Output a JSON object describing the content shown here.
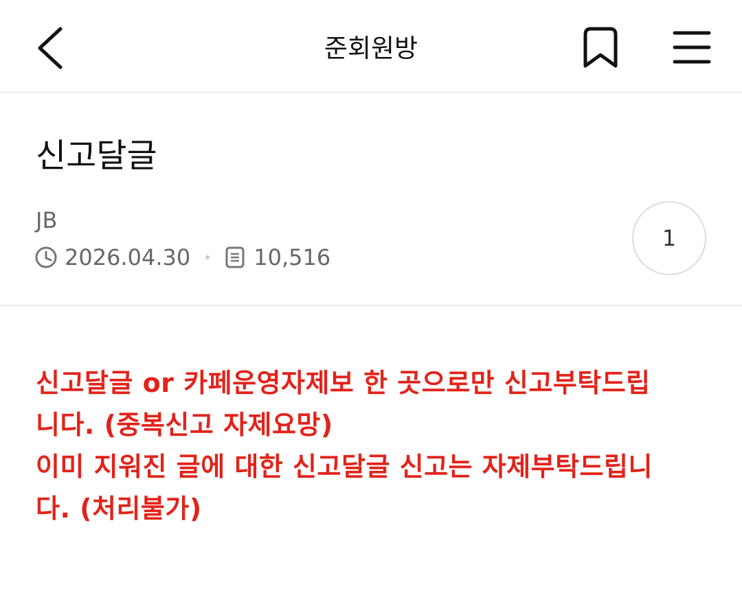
{
  "topbar": {
    "title": "준회원방",
    "back_icon": "chevron-left-icon",
    "bookmark_icon": "bookmark-icon",
    "menu_icon": "hamburger-menu-icon"
  },
  "post": {
    "title": "신고달글",
    "author": "JB",
    "date": "2026.04.30",
    "views": "10,516",
    "comment_count": "1"
  },
  "content": {
    "notice_lines": [
      "신고달글 or 카페운영자제보 한 곳으로만 신고부탁드립",
      "니다. (중복신고 자제요망)",
      "이미 지워진 글에 대한 신고달글 신고는 자제부탁드립니",
      "다. (처리불가)"
    ],
    "notice_color": "#e2231a"
  }
}
